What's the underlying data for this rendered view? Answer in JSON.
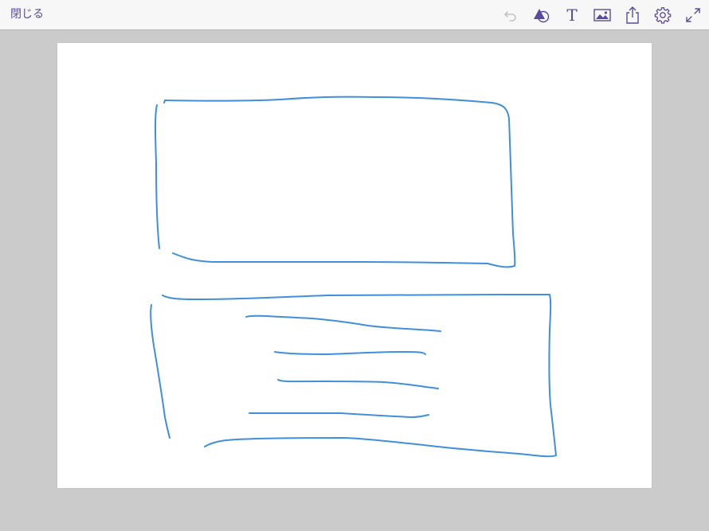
{
  "toolbar": {
    "close_label": "閉じる",
    "tools": [
      {
        "name": "undo-icon",
        "enabled": false
      },
      {
        "name": "shapes-icon",
        "enabled": true
      },
      {
        "name": "text-icon",
        "label": "T",
        "enabled": true
      },
      {
        "name": "image-icon",
        "enabled": true
      },
      {
        "name": "share-icon",
        "enabled": true
      },
      {
        "name": "gear-icon",
        "enabled": true
      },
      {
        "name": "expand-icon",
        "enabled": true
      }
    ]
  },
  "colors": {
    "accent": "#5b4a9b",
    "disabled": "#b9b9bd",
    "ink": "#3f8fdb",
    "workspace": "#cbcbcb",
    "toolbar_bg": "#f7f7f7",
    "page": "#ffffff"
  }
}
